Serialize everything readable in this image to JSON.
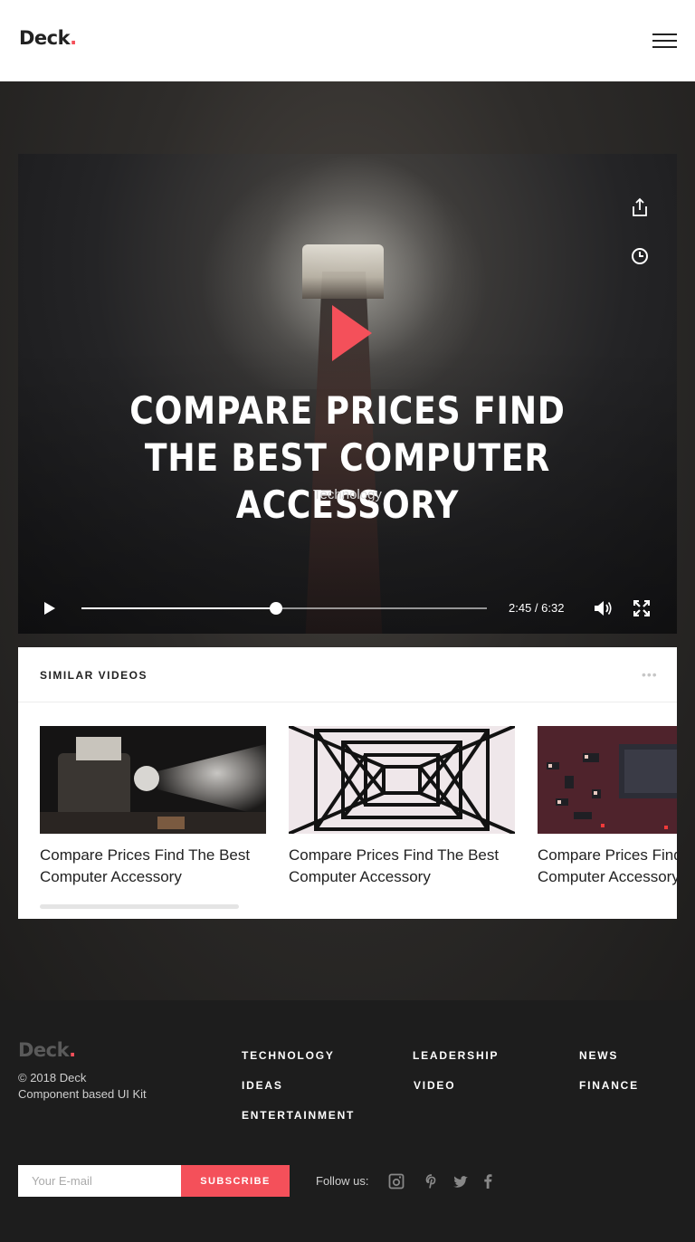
{
  "header": {
    "logo_text": "Deck",
    "logo_dot": "."
  },
  "player": {
    "title": "COMPARE PRICES FIND THE BEST COMPUTER ACCESSORY",
    "category": "Technology",
    "time_display": "2:45 / 6:32",
    "progress_fraction": 0.48,
    "side_icons": [
      "share-icon",
      "clock-icon"
    ],
    "accent": "#f4505a"
  },
  "similar": {
    "title": "SIMILAR VIDEOS",
    "more": "•••",
    "videos": [
      {
        "title": "Compare Prices Find The Best Computer Accessory",
        "thumb": "projector"
      },
      {
        "title": "Compare Prices Find The Best Computer Accessory",
        "thumb": "power-tower"
      },
      {
        "title": "Compare Prices Find The Best Computer Accessory",
        "thumb": "circuit-board"
      }
    ]
  },
  "footer": {
    "logo_text": "Deck",
    "logo_dot": ".",
    "copyright": "© 2018 Deck",
    "tagline": "Component based UI Kit",
    "links": [
      "TECHNOLOGY",
      "IDEAS",
      "ENTERTAINMENT",
      "LEADERSHIP",
      "VIDEO",
      "NEWS",
      "FINANCE"
    ],
    "email_placeholder": "Your E-mail",
    "subscribe_label": "SUBSCRIBE",
    "follow_label": "Follow us:",
    "social_icons": [
      "instagram-icon",
      "pinterest-icon",
      "twitter-icon",
      "facebook-icon"
    ]
  }
}
